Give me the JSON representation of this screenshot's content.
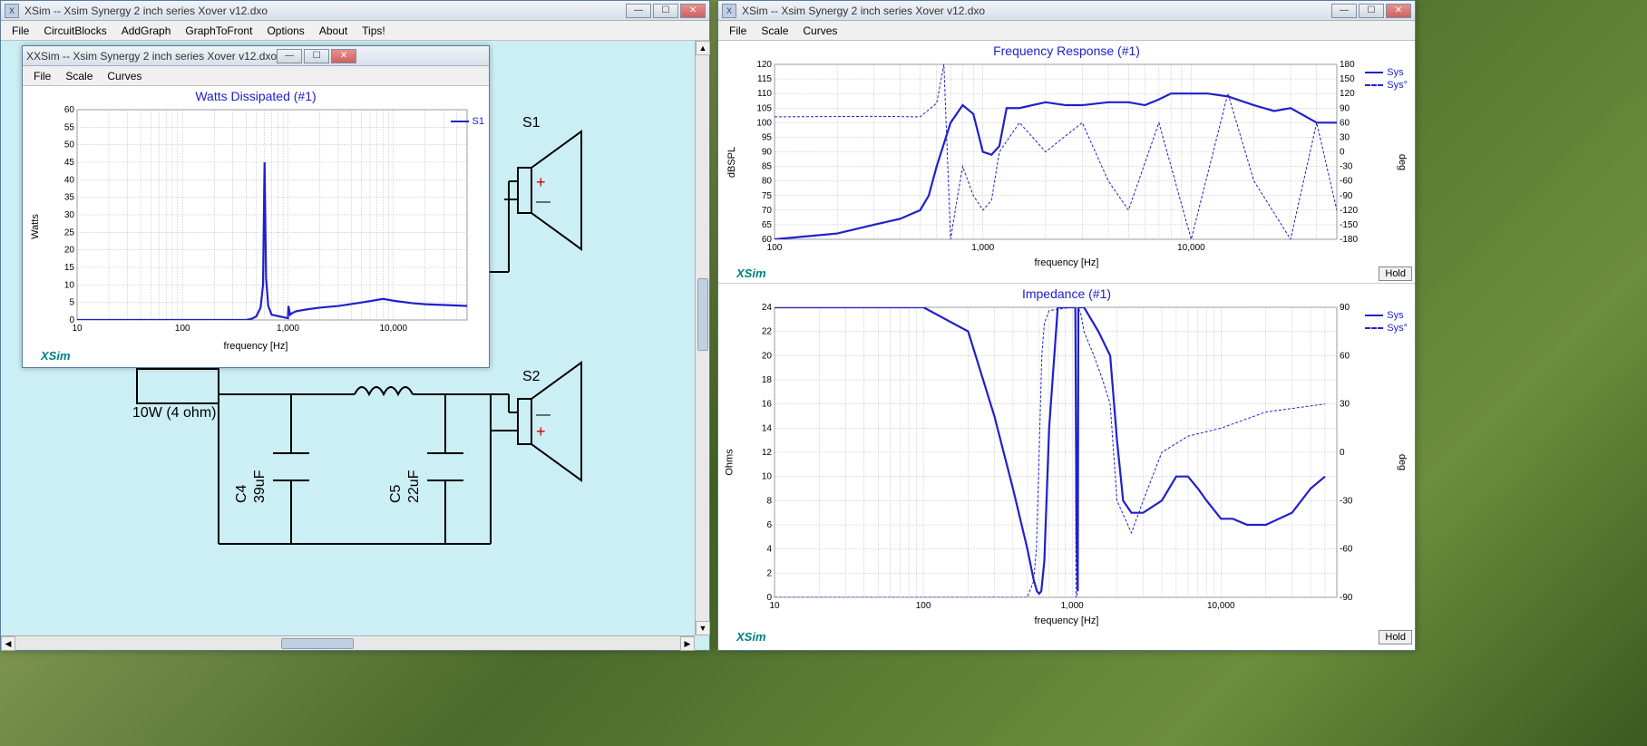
{
  "main_window": {
    "title": "XSim -- Xsim Synergy 2 inch series Xover v12.dxo",
    "menu": [
      "File",
      "CircuitBlocks",
      "AddGraph",
      "GraphToFront",
      "Options",
      "About",
      "Tips!"
    ]
  },
  "sub_window_watts": {
    "title": "XSim -- Xsim Synergy 2 inch series Xover v12.dxo",
    "menu": [
      "File",
      "Scale",
      "Curves"
    ]
  },
  "right_window": {
    "title": "XSim -- Xsim Synergy 2 inch series Xover v12.dxo",
    "menu": [
      "File",
      "Scale",
      "Curves"
    ]
  },
  "circuit": {
    "source_label": "10W (4 ohm)",
    "c4_label": "C4",
    "c4_value": "39uF",
    "c5_label": "C5",
    "c5_value": "22uF",
    "s1_label": "S1",
    "s2_label": "S2"
  },
  "brand": "XSim",
  "hold_label": "Hold",
  "legend_sys": "Sys",
  "legend_sys_phase": "Sys°",
  "legend_s1": "S1",
  "chart_data": [
    {
      "type": "line",
      "title": "Watts Dissipated (#1)",
      "xlabel": "frequency [Hz]",
      "ylabel": "Watts",
      "xscale": "log",
      "xlim": [
        10,
        50000
      ],
      "ylim": [
        0,
        60
      ],
      "xticks": [
        10,
        100,
        1000,
        10000
      ],
      "yticks": [
        0,
        5,
        10,
        15,
        20,
        25,
        30,
        35,
        40,
        45,
        50,
        55,
        60
      ],
      "series": [
        {
          "name": "S1",
          "color": "#2020cc",
          "x": [
            10,
            200,
            300,
            400,
            450,
            500,
            550,
            580,
            600,
            620,
            650,
            700,
            1000,
            1010,
            1050,
            1100,
            1200,
            1500,
            2000,
            3000,
            5000,
            8000,
            10000,
            15000,
            20000,
            50000
          ],
          "y": [
            0,
            0,
            0,
            0,
            0.3,
            1,
            3.5,
            10,
            45,
            12,
            4,
            1.5,
            0.5,
            4,
            1.5,
            2,
            2.5,
            3,
            3.5,
            4,
            5,
            6,
            5.5,
            4.8,
            4.5,
            4
          ]
        }
      ]
    },
    {
      "type": "line",
      "title": "Frequency Response (#1)",
      "xlabel": "frequency [Hz]",
      "ylabel": "dBSPL",
      "y2label": "deg",
      "xscale": "log",
      "xlim": [
        100,
        50000
      ],
      "ylim": [
        60,
        120
      ],
      "y2lim": [
        -180,
        180
      ],
      "xticks": [
        100,
        1000,
        10000
      ],
      "yticks": [
        60,
        65,
        70,
        75,
        80,
        85,
        90,
        95,
        100,
        105,
        110,
        115,
        120
      ],
      "y2ticks": [
        -180,
        -150,
        -120,
        -90,
        -60,
        -30,
        0,
        30,
        60,
        90,
        120,
        150,
        180
      ],
      "series": [
        {
          "name": "Sys",
          "color": "#2020cc",
          "style": "solid",
          "x": [
            100,
            200,
            300,
            400,
            500,
            550,
            600,
            700,
            800,
            900,
            1000,
            1100,
            1200,
            1300,
            1500,
            2000,
            2500,
            3000,
            4000,
            5000,
            6000,
            7000,
            8000,
            10000,
            12000,
            15000,
            20000,
            25000,
            30000,
            40000,
            50000
          ],
          "y": [
            60,
            62,
            65,
            67,
            70,
            75,
            85,
            100,
            106,
            103,
            90,
            89,
            92,
            105,
            105,
            107,
            106,
            106,
            107,
            107,
            106,
            108,
            110,
            110,
            110,
            109,
            106,
            104,
            105,
            100,
            100
          ]
        },
        {
          "name": "Sys°",
          "color": "#2020cc",
          "style": "dash",
          "x": [
            100,
            300,
            500,
            600,
            650,
            700,
            750,
            800,
            900,
            1000,
            1100,
            1200,
            1500,
            2000,
            3000,
            4000,
            5000,
            7000,
            10000,
            15000,
            20000,
            30000,
            40000,
            50000
          ],
          "y": [
            72,
            73,
            72,
            100,
            180,
            -180,
            -100,
            -30,
            -90,
            -120,
            -100,
            0,
            60,
            0,
            60,
            -60,
            -120,
            60,
            -180,
            120,
            -60,
            -180,
            60,
            -120
          ]
        }
      ]
    },
    {
      "type": "line",
      "title": "Impedance (#1)",
      "xlabel": "frequency [Hz]",
      "ylabel": "Ohms",
      "y2label": "deg",
      "xscale": "log",
      "xlim": [
        10,
        60000
      ],
      "ylim": [
        0,
        24
      ],
      "y2lim": [
        -90,
        90
      ],
      "xticks": [
        10,
        100,
        1000,
        10000
      ],
      "yticks": [
        0,
        2,
        4,
        6,
        8,
        10,
        12,
        14,
        16,
        18,
        20,
        22,
        24
      ],
      "y2ticks": [
        -90,
        -60,
        -30,
        0,
        30,
        60,
        90
      ],
      "series": [
        {
          "name": "Sys",
          "color": "#2020cc",
          "style": "solid",
          "x": [
            10,
            50,
            100,
            200,
            300,
            400,
            500,
            550,
            580,
            600,
            620,
            650,
            700,
            800,
            900,
            1000,
            1050,
            1070,
            1090,
            1100,
            1200,
            1500,
            1800,
            2000,
            2200,
            2500,
            3000,
            4000,
            5000,
            6000,
            7000,
            8000,
            10000,
            12000,
            15000,
            20000,
            30000,
            40000,
            50000
          ],
          "y": [
            24,
            24,
            24,
            22,
            15,
            9,
            4,
            1.5,
            0.5,
            0.3,
            0.5,
            3,
            14,
            24,
            24,
            24,
            24,
            5,
            0.5,
            24,
            24,
            22,
            20,
            13,
            8,
            7,
            7,
            8,
            10,
            10,
            9,
            8,
            6.5,
            6.5,
            6,
            6,
            7,
            9,
            10
          ]
        },
        {
          "name": "Sys°",
          "color": "#2020cc",
          "style": "dash",
          "x": [
            10,
            100,
            200,
            400,
            500,
            550,
            575,
            600,
            625,
            650,
            700,
            1000,
            1050,
            1060,
            1080,
            1100,
            1150,
            1200,
            1400,
            1600,
            1800,
            2000,
            2500,
            3000,
            4000,
            6000,
            10000,
            20000,
            50000
          ],
          "y": [
            -90,
            -90,
            -90,
            -90,
            -90,
            -80,
            -60,
            0,
            60,
            80,
            88,
            90,
            90,
            -90,
            -90,
            90,
            85,
            75,
            60,
            45,
            30,
            -30,
            -50,
            -30,
            0,
            10,
            15,
            25,
            30
          ]
        }
      ]
    }
  ]
}
